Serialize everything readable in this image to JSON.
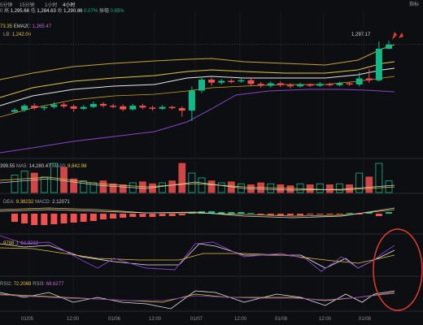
{
  "toolbar": {
    "intervals": [
      "5分钟",
      "15分钟",
      "1小时",
      "4小时"
    ],
    "active_index": 3,
    "price_readout": {
      "open_val": "0",
      "high_label": "高",
      "high_val": "1,295.66",
      "low_label": "低",
      "low_val": "1,284.63",
      "close_label": "收",
      "close_val": "1,290.86",
      "change_pct": "0.07%",
      "amp_label": "振幅",
      "amp_val": "0.85%"
    },
    "right_label": "指标"
  },
  "main_legend": {
    "ma_val": "73.35",
    "ema20_label": "EMA20:",
    "ema20_val": "1,265.47",
    "lb_label": "LB:",
    "lb_val": "1,242.06"
  },
  "price_marker": "1,297.17",
  "volume_legend": {
    "vol_val": "399.55",
    "ma5_label": "MA5:",
    "ma5_val": "14,280.47",
    "ma10_label": "MA10:",
    "ma10_val": "9,842.98"
  },
  "macd_legend": {
    "dea_label": "DEA:",
    "dea_val": "9.38232",
    "macd_label": "MACD:",
    "macd_val": "2.12071"
  },
  "kdj_legend": {
    "d_val": "9798",
    "j_label": "J:",
    "j_val": "84.9232"
  },
  "rsi_legend": {
    "rsi2_label": "RSI2:",
    "rsi2_val": "72.2069",
    "rsi3_label": "RSI3:",
    "rsi3_val": "68.6277"
  },
  "x_axis": [
    "01/05",
    "12:00",
    "01/06",
    "12:00",
    "01/07",
    "12:00",
    "01/08",
    "12:00",
    "01/09"
  ],
  "colors": {
    "up": "#12b886",
    "down": "#f0504e",
    "ma_yellow": "#e8c33a",
    "ma_purple": "#8a42c8",
    "line_white": "#e7e7e7",
    "annotation": "#e33b2e"
  },
  "icon": "flag-icon",
  "candles": [
    {
      "o": 1180,
      "c": 1183,
      "h": 1186,
      "l": 1177
    },
    {
      "o": 1183,
      "c": 1190,
      "h": 1193,
      "l": 1180
    },
    {
      "o": 1190,
      "c": 1186,
      "h": 1194,
      "l": 1183
    },
    {
      "o": 1186,
      "c": 1188,
      "h": 1191,
      "l": 1182
    },
    {
      "o": 1188,
      "c": 1192,
      "h": 1196,
      "l": 1185
    },
    {
      "o": 1192,
      "c": 1189,
      "h": 1195,
      "l": 1186
    },
    {
      "o": 1189,
      "c": 1185,
      "h": 1192,
      "l": 1180
    },
    {
      "o": 1185,
      "c": 1188,
      "h": 1191,
      "l": 1183
    },
    {
      "o": 1188,
      "c": 1193,
      "h": 1197,
      "l": 1186
    },
    {
      "o": 1193,
      "c": 1190,
      "h": 1196,
      "l": 1187
    },
    {
      "o": 1190,
      "c": 1189,
      "h": 1193,
      "l": 1186
    },
    {
      "o": 1189,
      "c": 1184,
      "h": 1192,
      "l": 1181
    },
    {
      "o": 1184,
      "c": 1190,
      "h": 1193,
      "l": 1182
    },
    {
      "o": 1190,
      "c": 1187,
      "h": 1193,
      "l": 1184
    },
    {
      "o": 1187,
      "c": 1185,
      "h": 1190,
      "l": 1182
    },
    {
      "o": 1185,
      "c": 1188,
      "h": 1191,
      "l": 1183
    },
    {
      "o": 1188,
      "c": 1186,
      "h": 1190,
      "l": 1184
    },
    {
      "o": 1186,
      "c": 1182,
      "h": 1189,
      "l": 1172
    },
    {
      "o": 1182,
      "c": 1215,
      "h": 1222,
      "l": 1165
    },
    {
      "o": 1215,
      "c": 1233,
      "h": 1238,
      "l": 1211
    },
    {
      "o": 1233,
      "c": 1228,
      "h": 1236,
      "l": 1223
    },
    {
      "o": 1228,
      "c": 1231,
      "h": 1234,
      "l": 1225
    },
    {
      "o": 1231,
      "c": 1230,
      "h": 1234,
      "l": 1227
    },
    {
      "o": 1230,
      "c": 1232,
      "h": 1236,
      "l": 1228
    },
    {
      "o": 1232,
      "c": 1226,
      "h": 1235,
      "l": 1222
    },
    {
      "o": 1226,
      "c": 1223,
      "h": 1229,
      "l": 1220
    },
    {
      "o": 1223,
      "c": 1227,
      "h": 1230,
      "l": 1220
    },
    {
      "o": 1227,
      "c": 1224,
      "h": 1230,
      "l": 1221
    },
    {
      "o": 1224,
      "c": 1222,
      "h": 1227,
      "l": 1219
    },
    {
      "o": 1222,
      "c": 1225,
      "h": 1228,
      "l": 1220
    },
    {
      "o": 1225,
      "c": 1223,
      "h": 1227,
      "l": 1221
    },
    {
      "o": 1223,
      "c": 1226,
      "h": 1229,
      "l": 1221
    },
    {
      "o": 1226,
      "c": 1224,
      "h": 1228,
      "l": 1222
    },
    {
      "o": 1224,
      "c": 1227,
      "h": 1230,
      "l": 1222
    },
    {
      "o": 1227,
      "c": 1225,
      "h": 1229,
      "l": 1223
    },
    {
      "o": 1225,
      "c": 1235,
      "h": 1245,
      "l": 1222
    },
    {
      "o": 1235,
      "c": 1232,
      "h": 1250,
      "l": 1228
    },
    {
      "o": 1232,
      "c": 1284,
      "h": 1296,
      "l": 1230
    },
    {
      "o": 1284,
      "c": 1291,
      "h": 1297,
      "l": 1283
    }
  ]
}
